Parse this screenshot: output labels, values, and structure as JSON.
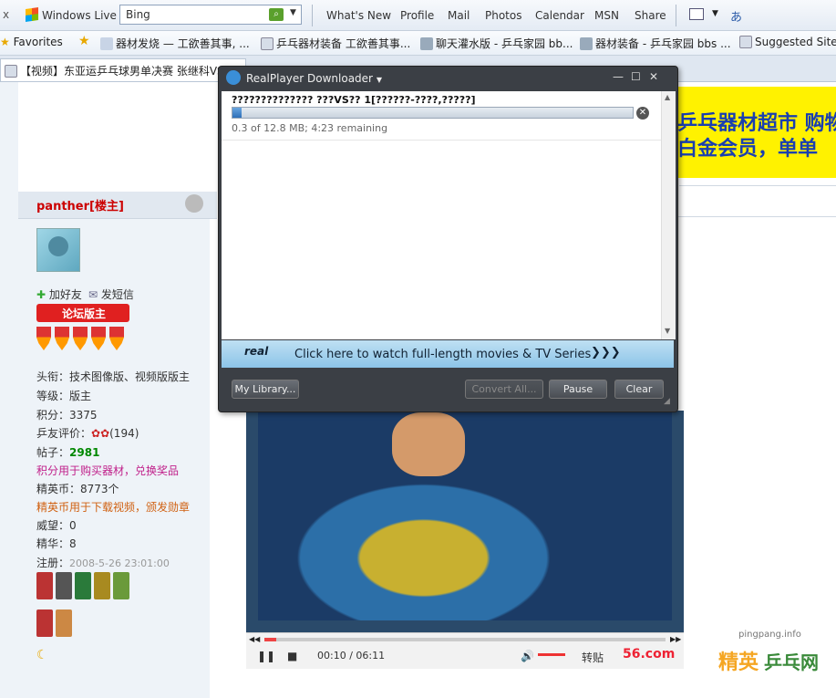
{
  "toolbar": {
    "close_glyph": "x",
    "brand": "Windows Live",
    "search_value": "Bing",
    "links": [
      "What's New",
      "Profile",
      "Mail",
      "Photos",
      "Calendar",
      "MSN",
      "Share"
    ]
  },
  "favorites_bar": {
    "favorites_label": "Favorites",
    "items": [
      "器材发烧 — 工欲善其事, ...",
      "乒乓器材装备 工欲善其事...",
      "聊天灌水版 - 乒乓家园 bb...",
      "器材装备 - 乒乓家园 bbs ...",
      "Suggested Sites"
    ]
  },
  "tab": {
    "title": "【视频】东亚运乒乓球男单决赛 张继科VS..."
  },
  "banner": {
    "line1": "乒乓器材超市 购物",
    "line2": "白金会员，单单"
  },
  "profile": {
    "username": "panther",
    "role_tag": "[楼主]",
    "add_friend": "加好友",
    "send_message": "发短信",
    "badge": "论坛版主",
    "title_line": "头衔：技术图像版、视频版版主",
    "level_line": "等级：版主",
    "points_line": "积分：3375",
    "rating_label": "乒友评价：",
    "rating_count": "(194)",
    "posts_label": "帖子：",
    "posts_value": "2981",
    "points_note": "积分用于购买器材，兑换奖品",
    "coins_line": "精英币：8773个",
    "coins_note": "精英币用于下载视频，颁发勋章",
    "prestige_line": "威望：0",
    "essence_line": "精华：8",
    "register_label": "注册：",
    "register_value": "2008-5-26 23:01:00"
  },
  "player": {
    "time": "00:10 / 06:11",
    "forward": "转贴",
    "logo": "56.com",
    "progress": 0.03
  },
  "watermark": {
    "url": "pingpang.info",
    "brand_a": "精英",
    "brand_b": "乒乓网"
  },
  "downloader": {
    "title": "RealPlayer Downloader",
    "filename": "?????????????? ???VS?? 1[??????-????,?????]",
    "status": "0.3 of 12.8 MB; 4:23 remaining",
    "progress": 0.023,
    "promo_logo": "real",
    "promo_text": "Click here to watch full-length movies & TV Series",
    "promo_arrows": "❯❯❯",
    "buttons": {
      "library": "My Library...",
      "convert": "Convert All...",
      "pause": "Pause",
      "clear": "Clear"
    }
  }
}
